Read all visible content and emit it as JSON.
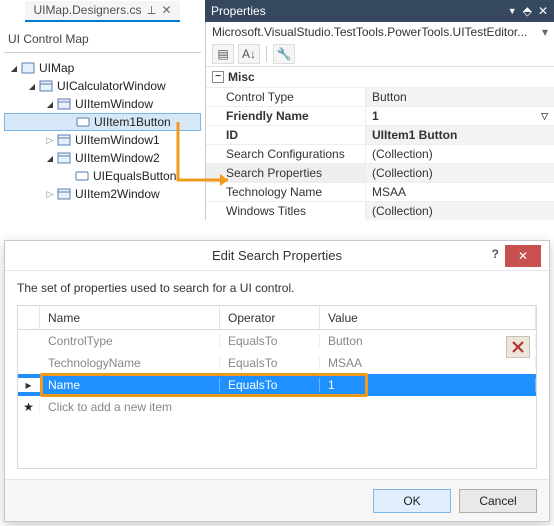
{
  "tab": {
    "file": "UIMap.Designers.cs"
  },
  "left": {
    "title": "UI Control Map",
    "nodes": {
      "root": "UIMap",
      "calc": "UICalculatorWindow",
      "itemwin": "UIItemWindow",
      "item1btn": "UIItem1Button",
      "itemwin1": "UIItemWindow1",
      "itemwin2": "UIItemWindow2",
      "equalsbtn": "UIEqualsButton",
      "item2win": "UIItem2Window"
    }
  },
  "props": {
    "title": "Properties",
    "object": "Microsoft.VisualStudio.TestTools.PowerTools.UITestEditor...",
    "category": "Misc",
    "rows": {
      "controlType": {
        "n": "Control Type",
        "v": "Button"
      },
      "friendlyName": {
        "n": "Friendly Name",
        "v": "1"
      },
      "id": {
        "n": "ID",
        "v": "UIItem1 Button"
      },
      "searchConfigs": {
        "n": "Search Configurations",
        "v": "(Collection)"
      },
      "searchProps": {
        "n": "Search Properties",
        "v": "(Collection)"
      },
      "techName": {
        "n": "Technology Name",
        "v": "MSAA"
      },
      "winTitles": {
        "n": "Windows Titles",
        "v": "(Collection)"
      }
    }
  },
  "dialog": {
    "title": "Edit Search Properties",
    "desc": "The set of properties used to search for a UI control.",
    "cols": {
      "name": "Name",
      "op": "Operator",
      "val": "Value"
    },
    "rows": [
      {
        "name": "ControlType",
        "op": "EqualsTo",
        "val": "Button"
      },
      {
        "name": "TechnologyName",
        "op": "EqualsTo",
        "val": "MSAA"
      },
      {
        "name": "Name",
        "op": "EqualsTo",
        "val": "1"
      }
    ],
    "newRow": "Click to add a new item",
    "ok": "OK",
    "cancel": "Cancel"
  }
}
